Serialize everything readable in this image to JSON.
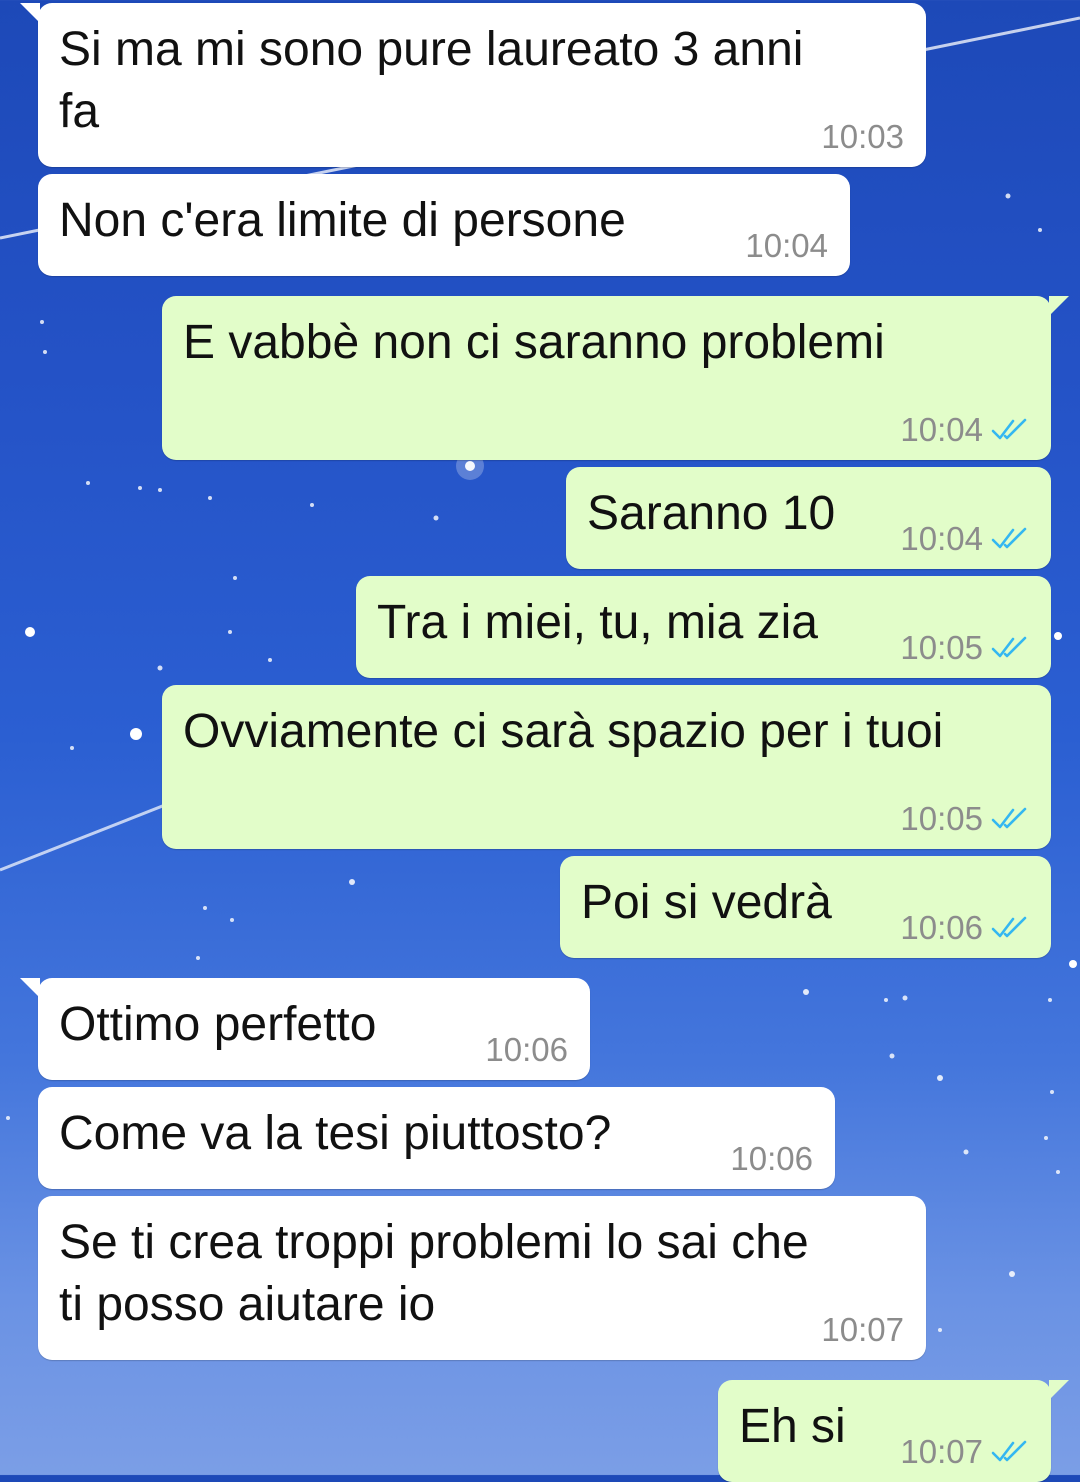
{
  "colors": {
    "incoming_bubble": "#ffffff",
    "outgoing_bubble": "#e2fdc9",
    "timestamp": "#8c8c8c",
    "read_ticks": "#34b7f1",
    "background_top": "#1d49b8",
    "background_bottom": "#7b9ee6"
  },
  "icons": {
    "read_receipt": "double-check-icon"
  },
  "messages": [
    {
      "direction": "incoming",
      "text": "Si ma mi sono pure laureato 3 anni\nfa",
      "time": "10:03"
    },
    {
      "direction": "incoming",
      "text": "Non c'era limite di persone",
      "time": "10:04"
    },
    {
      "direction": "outgoing",
      "text": "E vabbè non ci saranno problemi",
      "time": "10:04",
      "status": "read"
    },
    {
      "direction": "outgoing",
      "text": "Saranno 10",
      "time": "10:04",
      "status": "read"
    },
    {
      "direction": "outgoing",
      "text": "Tra i miei, tu, mia zia",
      "time": "10:05",
      "status": "read"
    },
    {
      "direction": "outgoing",
      "text": "Ovviamente ci sarà spazio per i tuoi",
      "time": "10:05",
      "status": "read"
    },
    {
      "direction": "outgoing",
      "text": "Poi si vedrà",
      "time": "10:06",
      "status": "read"
    },
    {
      "direction": "incoming",
      "text": "Ottimo perfetto",
      "time": "10:06"
    },
    {
      "direction": "incoming",
      "text": "Come va la tesi piuttosto?",
      "time": "10:06"
    },
    {
      "direction": "incoming",
      "text": "Se ti crea troppi problemi lo sai che\nti posso aiutare io",
      "time": "10:07"
    },
    {
      "direction": "outgoing",
      "text": "Eh si",
      "time": "10:07",
      "status": "read"
    }
  ]
}
